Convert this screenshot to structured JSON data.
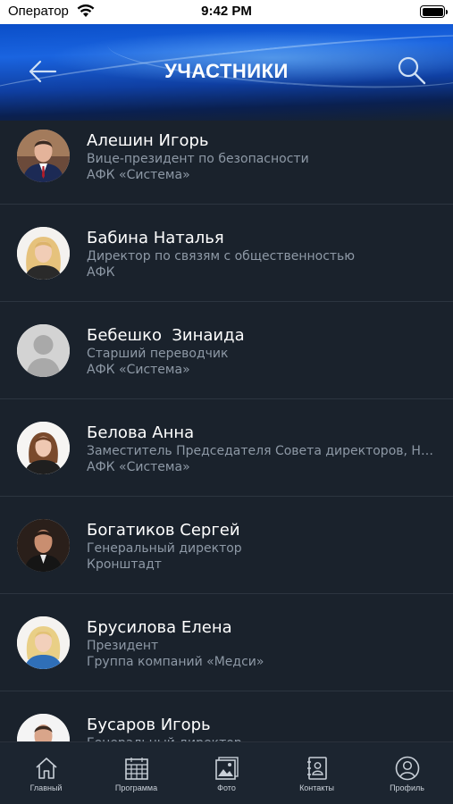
{
  "status_bar": {
    "carrier": "Оператор",
    "time": "9:42 PM"
  },
  "header": {
    "title": "УЧАСТНИКИ",
    "back_icon": "arrow-left-icon",
    "search_icon": "search-icon"
  },
  "participants": [
    {
      "name": "Алешин Игорь",
      "role": "Вице-президент по безопасности",
      "company": "АФК «Система»"
    },
    {
      "name": "Бабина Наталья",
      "role": "Директор по связям с общественностью",
      "company": "АФК"
    },
    {
      "name": "Бебешко  Зинаида",
      "role": "Старший переводчик",
      "company": "АФК «Система»"
    },
    {
      "name": "Белова Анна",
      "role": "Заместитель Председателя Совета директоров, Неи...",
      "company": "АФК «Система»"
    },
    {
      "name": "Богатиков Сергей",
      "role": "Генеральный директор",
      "company": "Кронштадт"
    },
    {
      "name": "Брусилова Елена",
      "role": "Президент",
      "company": "Группа компаний «Медси»"
    },
    {
      "name": "Бусаров Игорь",
      "role": "Генеральный директор",
      "company": ""
    }
  ],
  "tabbar": [
    {
      "label": "Главный",
      "icon": "home-icon"
    },
    {
      "label": "Программа",
      "icon": "calendar-icon"
    },
    {
      "label": "Фото",
      "icon": "photo-icon"
    },
    {
      "label": "Контакты",
      "icon": "contacts-icon"
    },
    {
      "label": "Профиль",
      "icon": "profile-icon"
    }
  ],
  "colors": {
    "background": "#1a222c",
    "header": "#1a64e0",
    "secondary_text": "#8e99a6"
  }
}
